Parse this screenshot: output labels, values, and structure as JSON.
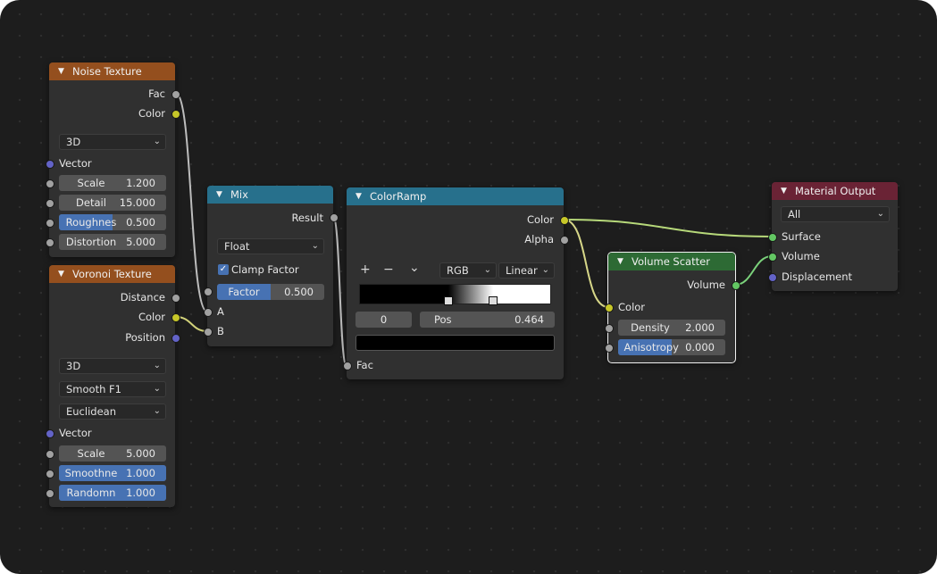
{
  "nodes": {
    "noise": {
      "title": "Noise Texture",
      "outputs": {
        "fac": "Fac",
        "color": "Color"
      },
      "dimensions": "3D",
      "inputs": {
        "vector": "Vector"
      },
      "fields": {
        "scale": {
          "label": "Scale",
          "value": "1.200"
        },
        "detail": {
          "label": "Detail",
          "value": "15.000"
        },
        "roughness": {
          "label": "Roughnes",
          "value": "0.500",
          "fill": 0.5
        },
        "distortion": {
          "label": "Distortion",
          "value": "5.000"
        }
      }
    },
    "voronoi": {
      "title": "Voronoi Texture",
      "outputs": {
        "distance": "Distance",
        "color": "Color",
        "position": "Position"
      },
      "dimensions": "3D",
      "feature": "Smooth F1",
      "metric": "Euclidean",
      "inputs": {
        "vector": "Vector"
      },
      "fields": {
        "scale": {
          "label": "Scale",
          "value": "5.000"
        },
        "smoothness": {
          "label": "Smoothne",
          "value": "1.000",
          "fill": 1.0
        },
        "randomness": {
          "label": "Randomn",
          "value": "1.000",
          "fill": 1.0
        }
      }
    },
    "mix": {
      "title": "Mix",
      "outputs": {
        "result": "Result"
      },
      "data_type": "Float",
      "clamp_label": "Clamp Factor",
      "clamp_checked": true,
      "factor": {
        "label": "Factor",
        "value": "0.500",
        "fill": 0.5
      },
      "inputs": {
        "a": "A",
        "b": "B"
      }
    },
    "colorramp": {
      "title": "ColorRamp",
      "outputs": {
        "color": "Color",
        "alpha": "Alpha"
      },
      "tools": {
        "add": "+",
        "remove": "−",
        "more": "⌄"
      },
      "color_mode": "RGB",
      "interpolation": "Linear",
      "active_index": "0",
      "pos": {
        "label": "Pos",
        "value": "0.464"
      },
      "stops": [
        0.464,
        0.7
      ],
      "active_color": "#000000",
      "inputs": {
        "fac": "Fac"
      }
    },
    "volume_scatter": {
      "title": "Volume Scatter",
      "outputs": {
        "volume": "Volume"
      },
      "inputs": {
        "color": "Color"
      },
      "fields": {
        "density": {
          "label": "Density",
          "value": "2.000"
        },
        "anisotropy": {
          "label": "Anisotropy",
          "value": "0.000",
          "fill": 0.5
        }
      }
    },
    "material_output": {
      "title": "Material Output",
      "target": "All",
      "inputs": {
        "surface": "Surface",
        "volume": "Volume",
        "displacement": "Displacement"
      }
    }
  },
  "colors": {
    "texture_header": "#944f1e",
    "converter_header": "#27708c",
    "shader_header": "#2d6a34",
    "output_header": "#6a2335",
    "socket_float": "#a1a1a1",
    "socket_color": "#c7c729",
    "socket_vector": "#6363c7",
    "socket_shader": "#63c763",
    "field_fill": "#4772b3"
  }
}
